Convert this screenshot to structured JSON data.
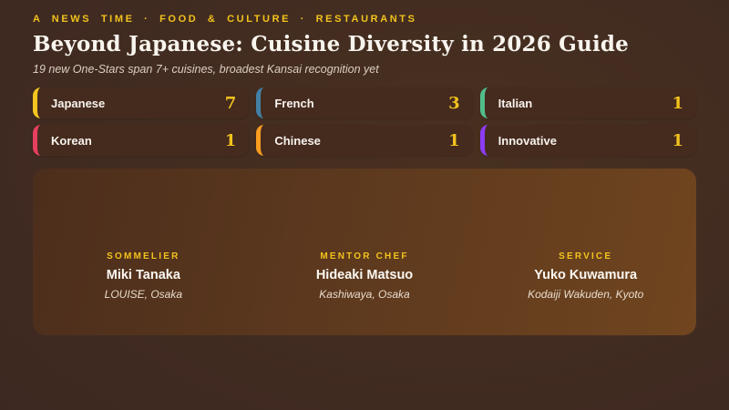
{
  "header": {
    "eyebrow": "A NEWS TIME · FOOD & CULTURE · RESTAURANTS",
    "title": "Beyond Japanese: Cuisine Diversity in 2026 Guide",
    "subtitle": "19 new One-Stars span 7+ cuisines, broadest Kansai recognition yet"
  },
  "cuisine_cards": [
    {
      "label": "Japanese",
      "count": "7",
      "accent": "#f3c520"
    },
    {
      "label": "French",
      "count": "3",
      "accent": "#4380a5"
    },
    {
      "label": "Italian",
      "count": "1",
      "accent": "#52bd8b"
    },
    {
      "label": "Korean",
      "count": "1",
      "accent": "#e73f5e"
    },
    {
      "label": "Chinese",
      "count": "1",
      "accent": "#f89d20"
    },
    {
      "label": "Innovative",
      "count": "1",
      "accent": "#8b3cf2"
    }
  ],
  "awards": [
    {
      "role": "SOMMELIER",
      "name": "Miki Tanaka",
      "restaurant": "LOUISE, Osaka"
    },
    {
      "role": "MENTOR CHEF",
      "name": "Hideaki Matsuo",
      "restaurant": "Kashiwaya, Osaka"
    },
    {
      "role": "SERVICE",
      "name": "Yuko Kuwamura",
      "restaurant": "Kodaiji Wakuden, Kyoto"
    }
  ],
  "colors": {
    "accent_gold": "#f2c31d",
    "page_background": "#3f2a21",
    "card_background": "#452a1e",
    "panel_gradient_start": "#4c2e1c",
    "panel_gradient_end": "#70451f"
  },
  "chart_data": {
    "type": "table",
    "title": "Beyond Japanese: Cuisine Diversity in 2026 Guide",
    "subtitle": "19 new One-Stars span 7+ cuisines, broadest Kansai recognition yet",
    "categories": [
      "Japanese",
      "French",
      "Italian",
      "Korean",
      "Chinese",
      "Innovative"
    ],
    "values": [
      7,
      3,
      1,
      1,
      1,
      1
    ],
    "annotations": [
      "SOMMELIER — Miki Tanaka — LOUISE, Osaka",
      "MENTOR CHEF — Hideaki Matsuo — Kashiwaya, Osaka",
      "SERVICE — Yuko Kuwamura — Kodaiji Wakuden, Kyoto"
    ]
  }
}
